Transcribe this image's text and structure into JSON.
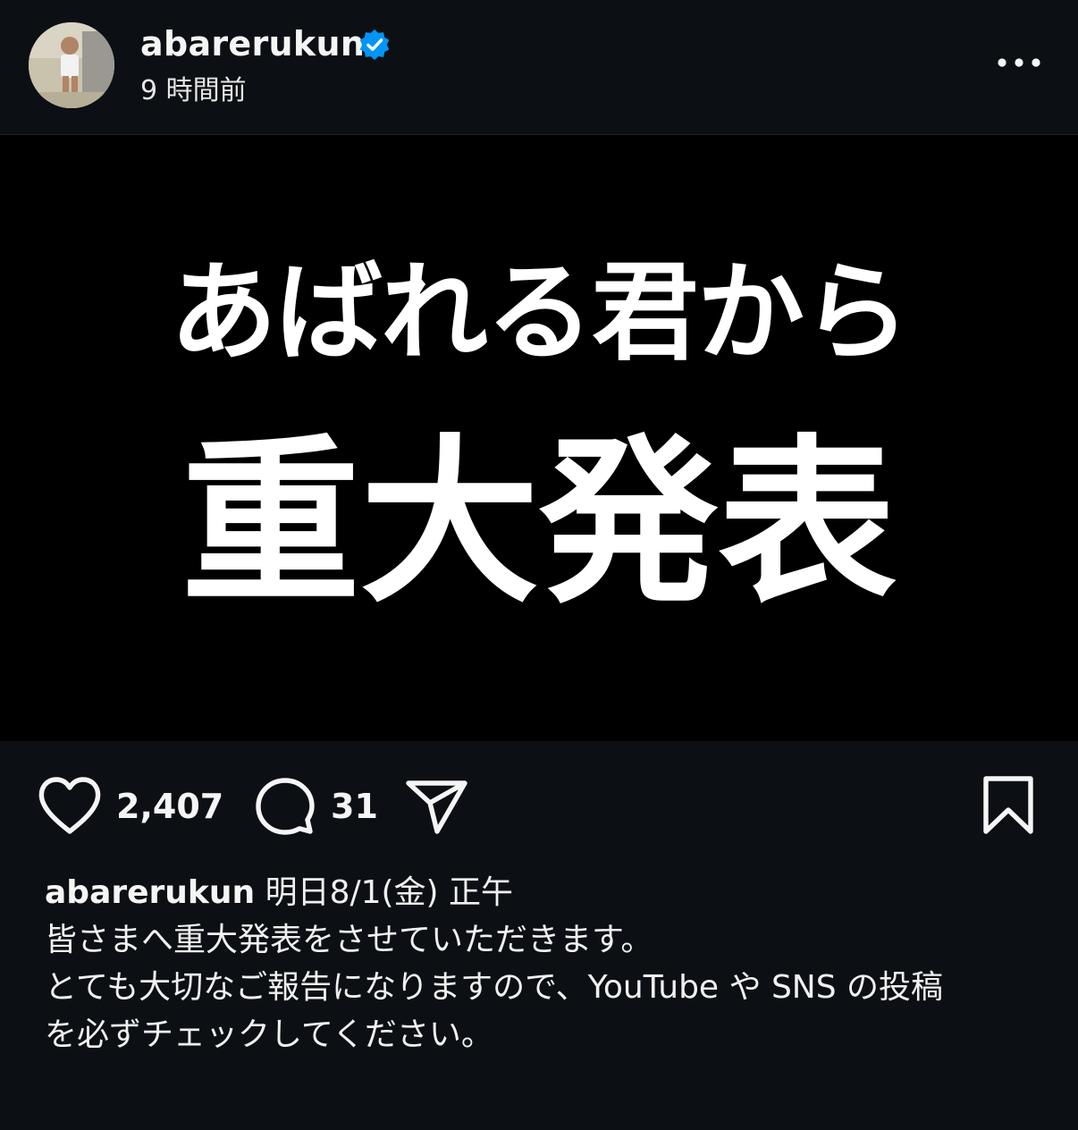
{
  "header": {
    "username": "abarerukun",
    "verified_icon": "verified-badge-icon",
    "timestamp": "9 時間前",
    "more_icon": "more-horizontal-icon"
  },
  "post_image": {
    "line1": "あばれる君から",
    "line2": "重大発表"
  },
  "actions": {
    "like_icon": "heart-icon",
    "like_count": "2,407",
    "comment_icon": "comment-bubble-icon",
    "comment_count": "31",
    "share_icon": "paper-plane-icon",
    "save_icon": "bookmark-icon"
  },
  "caption": {
    "username": "abarerukun",
    "line1": "明日8/1(金) 正午",
    "line2": "皆さまへ重大発表をさせていただきます。",
    "line3": "とても大切なご報告になりますので、YouTube や SNS の投稿",
    "line4": "を必ずチェックしてください。"
  },
  "colors": {
    "background": "#0c1014",
    "image_background": "#000000",
    "verified_blue": "#0095f6",
    "text": "#f5f5f5"
  }
}
